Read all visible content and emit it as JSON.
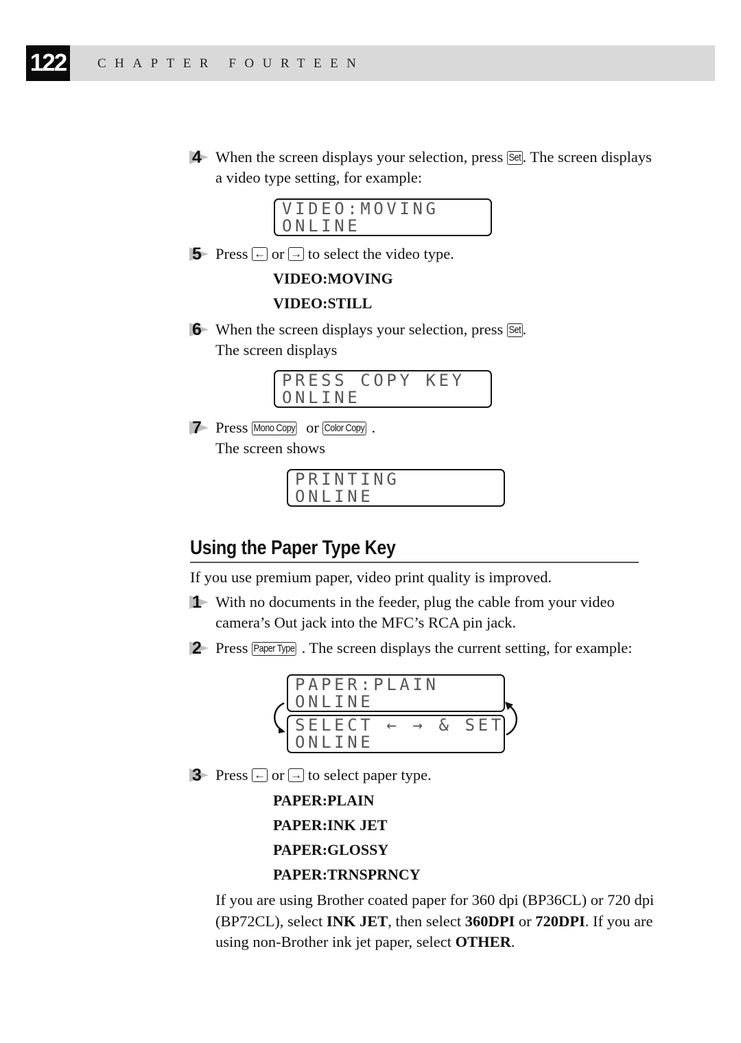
{
  "header": {
    "page_number": "122",
    "chapter": "CHAPTER FOURTEEN"
  },
  "steps_top": [
    {
      "number": "4",
      "line1_before": "When the screen displays your selection, press ",
      "key": "Set",
      "line1_after": ". The screen displays",
      "line2": "a video type setting, for example:",
      "lcd": [
        "VIDEO:MOVING",
        "ONLINE"
      ]
    },
    {
      "number": "5",
      "before": "Press ",
      "key_left": "←",
      "middle": " or ",
      "key_right": "→",
      "after": " to select the video type.",
      "options": [
        "VIDEO:MOVING",
        "VIDEO:STILL"
      ]
    },
    {
      "number": "6",
      "line1_before": "When the screen displays your selection, press ",
      "key": "Set",
      "line1_after": ".",
      "line2": "The screen displays",
      "lcd": [
        "PRESS COPY KEY",
        "ONLINE"
      ]
    },
    {
      "number": "7",
      "before": "Press ",
      "key1": "Mono Copy",
      "middle": " or ",
      "key2": "Color Copy",
      "after": ".",
      "line2": "The screen shows",
      "lcd": [
        "PRINTING",
        "ONLINE"
      ]
    }
  ],
  "section": {
    "title": "Using the Paper Type Key",
    "intro": "If you use premium paper, video print quality is improved.",
    "steps": [
      {
        "number": "1",
        "line1": "With no documents in the feeder, plug the cable from your video",
        "line2": "camera’s Out jack into the MFC’s RCA pin jack."
      },
      {
        "number": "2",
        "before": "Press ",
        "key": "Paper Type",
        "after": ". The screen displays the current setting, for example:",
        "lcd_a": [
          "PAPER:PLAIN",
          "ONLINE"
        ],
        "lcd_b": [
          "SELECT ← → & SET",
          "ONLINE"
        ]
      },
      {
        "number": "3",
        "before": "Press ",
        "key_left": "←",
        "middle": " or ",
        "key_right": "→",
        "after": " to select paper type.",
        "options": [
          "PAPER:PLAIN",
          "PAPER:INK JET",
          "PAPER:GLOSSY",
          "PAPER:TRNSPRNCY"
        ]
      }
    ],
    "note": {
      "l1": "If you are using Brother coated paper for 360 dpi (BP36CL) or 720 dpi",
      "l2_a": "(BP72CL), select ",
      "l2_b": "INK JET",
      "l2_c": ", then select ",
      "l2_d": "360DPI",
      "l2_e": " or ",
      "l2_f": "720DPI",
      "l2_g": ". If you are",
      "l3_a": "using non-Brother ink jet paper, select ",
      "l3_b": "OTHER",
      "l3_c": "."
    }
  }
}
